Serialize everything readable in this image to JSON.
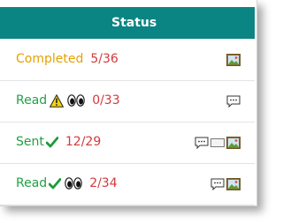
{
  "header": {
    "title": "Status"
  },
  "rows": [
    {
      "status": "Completed",
      "count": "5/36",
      "icons": [
        "image-icon"
      ]
    },
    {
      "status": "Read",
      "count": "0/33",
      "flags": [
        "warning-icon",
        "eyes-icon"
      ],
      "icons": [
        "speech-bubble-icon"
      ]
    },
    {
      "status": "Sent",
      "count": "12/29",
      "flags": [
        "checkmark-icon"
      ],
      "icons": [
        "speech-bubble-icon",
        "envelope-icon",
        "image-icon"
      ]
    },
    {
      "status": "Read",
      "count": "2/34",
      "flags": [
        "checkmark-icon",
        "eyes-icon"
      ],
      "icons": [
        "speech-bubble-icon",
        "image-icon"
      ]
    }
  ],
  "colors": {
    "header_bg": "#0b8484",
    "completed": "#e5a100",
    "read_sent": "#24a045",
    "count": "#d23a3a"
  }
}
